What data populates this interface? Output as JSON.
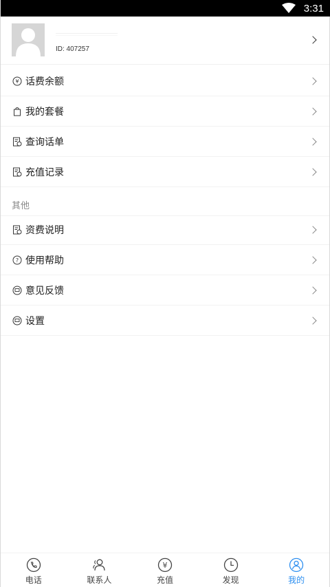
{
  "status_bar": {
    "time": "3:31"
  },
  "profile": {
    "id_text": "ID: 407257"
  },
  "menu_group1": [
    {
      "label": "话费余额",
      "icon": "yen-circle-icon"
    },
    {
      "label": "我的套餐",
      "icon": "bag-icon"
    },
    {
      "label": "查询话单",
      "icon": "bill-clock-icon"
    },
    {
      "label": "充值记录",
      "icon": "bill-clock-icon"
    }
  ],
  "section_other": {
    "title": "其他"
  },
  "menu_group2": [
    {
      "label": "资费说明",
      "icon": "bill-clock-icon"
    },
    {
      "label": "使用帮助",
      "icon": "question-circle-icon"
    },
    {
      "label": "意见反馈",
      "icon": "chat-icon"
    },
    {
      "label": "设置",
      "icon": "chat-icon"
    }
  ],
  "tabbar": {
    "tabs": [
      {
        "label": "电话",
        "icon": "phone-icon"
      },
      {
        "label": "联系人",
        "icon": "contacts-icon"
      },
      {
        "label": "充值",
        "icon": "yen-circle-icon"
      },
      {
        "label": "发现",
        "icon": "clock-icon"
      },
      {
        "label": "我的",
        "icon": "person-icon",
        "active": true
      }
    ],
    "active_color": "#2d8ff0"
  }
}
